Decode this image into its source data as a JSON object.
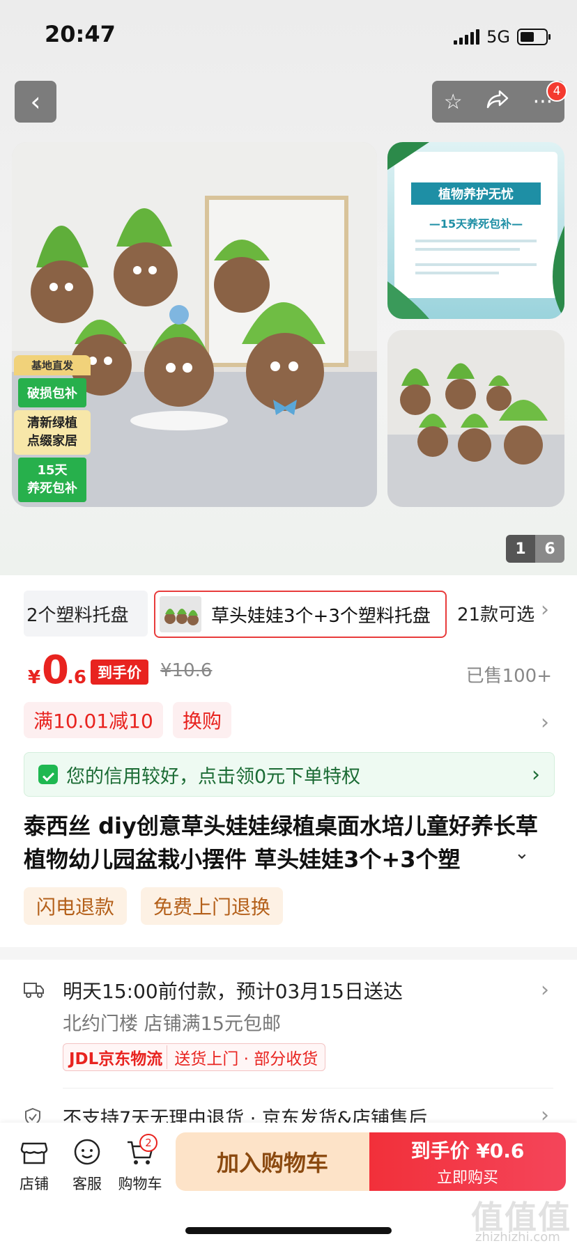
{
  "status_bar": {
    "time": "20:47",
    "network": "5G"
  },
  "nav": {
    "badge_count": "4"
  },
  "gallery": {
    "main_badges": [
      "基地直发",
      "破损包补",
      "清新绿植\n点缀家居",
      "15天\n养死包补"
    ],
    "side_card_title": "植物养护无忧",
    "side_card_subtitle": "—15天养死包补—",
    "pager_current": "1",
    "pager_total": "6"
  },
  "variants": {
    "items": [
      "2个塑料托盘",
      "草头娃娃3个+3个塑料托盘"
    ],
    "more": "21款可选"
  },
  "price": {
    "symbol": "¥",
    "integer": "0",
    "decimal": ".6",
    "tag": "到手价",
    "original": "¥10.6",
    "sold": "已售100+"
  },
  "promos": [
    "满10.01减10",
    "换购"
  ],
  "credit": {
    "text": "您的信用较好，点击领0元下单特权"
  },
  "product_title": "泰西丝 diy创意草头娃娃绿植桌面水培儿童好养长草植物幼儿园盆栽小摆件 草头娃娃3个+3个塑",
  "services": [
    "闪电退款",
    "免费上门退换"
  ],
  "delivery": {
    "line1": "明天15:00前付款，预计03月15日送达",
    "line2": "北约门楼   店铺满15元包邮",
    "logistics_logo": "JDL京东物流",
    "logistics_text": "送货上门 · 部分收货"
  },
  "returns": {
    "text": "不支持7天无理由退货 · 京东发货&店铺售后"
  },
  "bottom_bar": {
    "tabs": [
      {
        "label": "店铺",
        "icon": "store-icon"
      },
      {
        "label": "客服",
        "icon": "customer-service-icon"
      },
      {
        "label": "购物车",
        "icon": "cart-icon"
      }
    ],
    "cart_badge": "2",
    "add_to_cart": "加入购物车",
    "buy_line1": "到手价 ¥0.6",
    "buy_line2": "立即购买"
  },
  "watermark": {
    "main": "值值值",
    "sub": "zhizhizhi.com"
  },
  "colors": {
    "accent": "#e8231f",
    "credit_green": "#1fb851",
    "add_cart_bg": "#fde3c8"
  }
}
